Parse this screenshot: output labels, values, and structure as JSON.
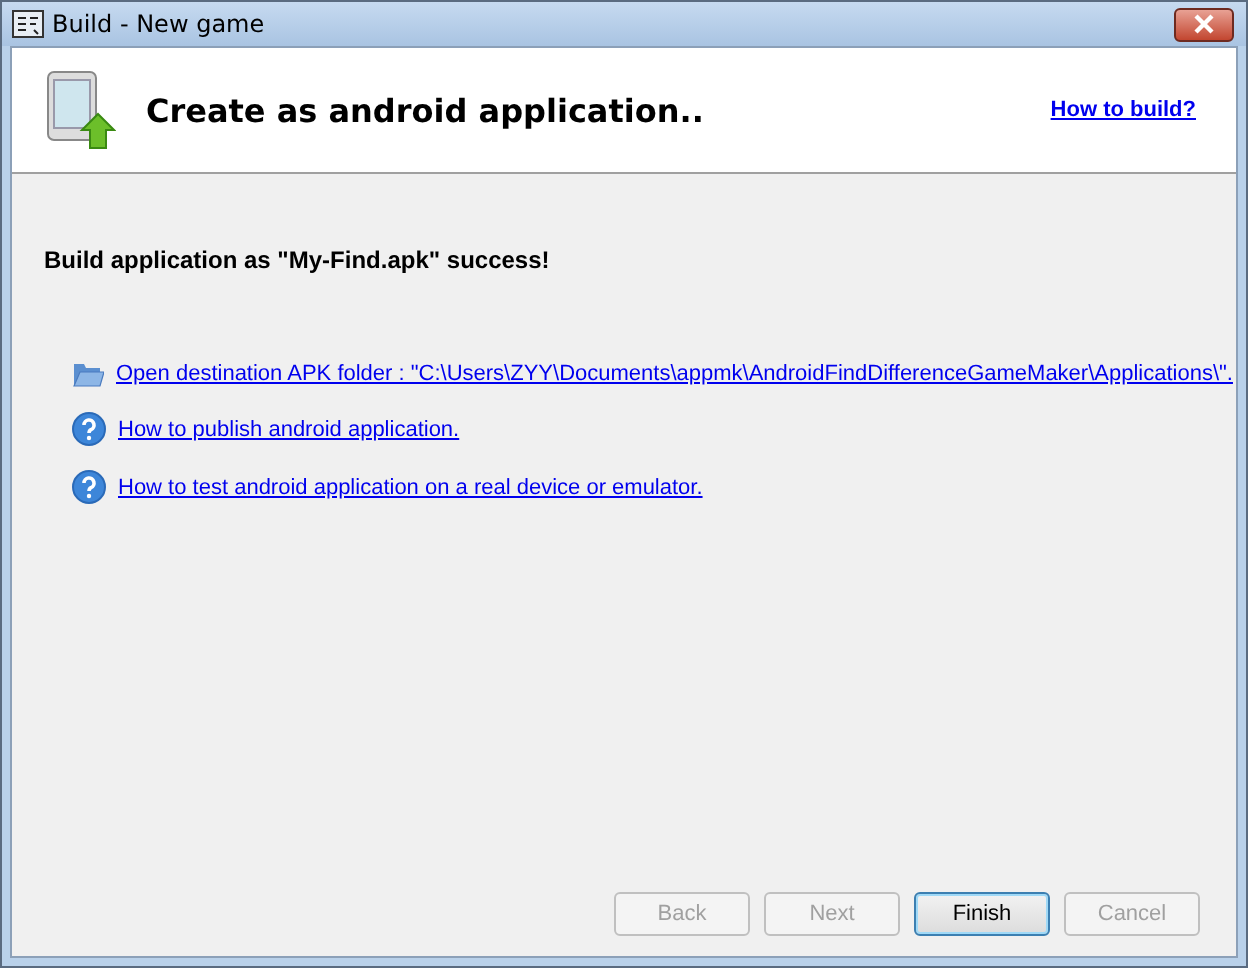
{
  "window": {
    "title": "Build - New game"
  },
  "header": {
    "title": "Create as android application..",
    "help_link": "How to build?"
  },
  "message": "Build application as \"My-Find.apk\" success!",
  "links": [
    {
      "kind": "folder",
      "text": "Open destination APK folder : \"C:\\Users\\ZYY\\Documents\\appmk\\AndroidFindDifferenceGameMaker\\Applications\\\"."
    },
    {
      "kind": "help",
      "text": "How to publish android application."
    },
    {
      "kind": "help",
      "text": "How to test android application on a real device or emulator."
    }
  ],
  "buttons": [
    {
      "label": "Back",
      "disabled": true,
      "default": false
    },
    {
      "label": "Next",
      "disabled": true,
      "default": false
    },
    {
      "label": "Finish",
      "disabled": false,
      "default": true
    },
    {
      "label": "Cancel",
      "disabled": true,
      "default": false
    }
  ]
}
